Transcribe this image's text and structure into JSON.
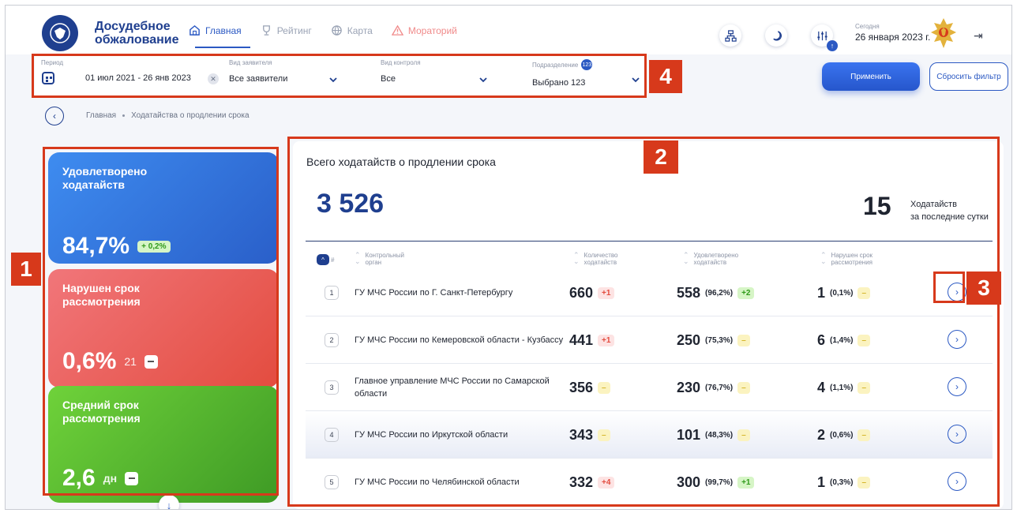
{
  "header": {
    "brand_line1": "Досудебное",
    "brand_line2": "обжалование",
    "nav": [
      {
        "label": "Главная",
        "icon": "home-icon"
      },
      {
        "label": "Рейтинг",
        "icon": "trophy-icon"
      },
      {
        "label": "Карта",
        "icon": "globe-icon"
      },
      {
        "label": "Мораторий",
        "icon": "warning-icon"
      }
    ],
    "today_label": "Сегодня",
    "today_value": "26 января 2023 г.",
    "notif_icon_mark": "↑"
  },
  "filters": {
    "period_label": "Период",
    "period_value": "01 июл 2021  -  26 янв 2023",
    "applicant_label": "Вид заявителя",
    "applicant_value": "Все заявители",
    "control_label": "Вид контроля",
    "control_value": "Все",
    "division_label": "Подразделение",
    "division_count": "123",
    "division_value": "Выбрано 123",
    "apply_label": "Применить",
    "reset_label": "Сбросить фильтр"
  },
  "breadcrumb": {
    "home": "Главная",
    "current": "Ходатайства о продлении срока"
  },
  "kpis": {
    "satisfied_title": "Удовлетворено ходатайств",
    "satisfied_value": "84,7%",
    "satisfied_delta": "+ 0,2%",
    "violated_title": "Нарушен срок рассмотрения",
    "violated_value": "0,6%",
    "violated_count": "21",
    "avg_title": "Средний срок рассмотрения",
    "avg_value": "2,6",
    "avg_unit": "дн"
  },
  "panel": {
    "title": "Всего ходатайств о продлении срока",
    "total": "3 526",
    "last_day_value": "15",
    "last_day_label_1": "Ходатайств",
    "last_day_label_2": "за последние сутки",
    "columns": {
      "num": "#",
      "org_1": "Контрольный",
      "org_2": "орган",
      "count_1": "Количество",
      "count_2": "ходатайств",
      "satisfied_1": "Удовлетворено",
      "satisfied_2": "ходатайств",
      "violated_1": "Нарушен срок",
      "violated_2": "рассмотрения"
    },
    "rows": [
      {
        "rank": "1",
        "org": "ГУ МЧС России по Г. Санкт-Петербургу",
        "count": "660",
        "count_delta": "+1",
        "satisfied": "558",
        "satisfied_pct": "(96,2%)",
        "satisfied_delta": "+2",
        "violated": "1",
        "violated_pct": "(0,1%)",
        "violated_delta": "–"
      },
      {
        "rank": "2",
        "org": "ГУ МЧС России по Кемеровской области - Кузбассу",
        "count": "441",
        "count_delta": "+1",
        "satisfied": "250",
        "satisfied_pct": "(75,3%)",
        "satisfied_delta": "–",
        "violated": "6",
        "violated_pct": "(1,4%)",
        "violated_delta": "–"
      },
      {
        "rank": "3",
        "org": "Главное управление МЧС России по Самарской области",
        "count": "356",
        "count_delta": "–",
        "satisfied": "230",
        "satisfied_pct": "(76,7%)",
        "satisfied_delta": "–",
        "violated": "4",
        "violated_pct": "(1,1%)",
        "violated_delta": "–"
      },
      {
        "rank": "4",
        "org": "ГУ МЧС России по Иркутской области",
        "count": "343",
        "count_delta": "–",
        "satisfied": "101",
        "satisfied_pct": "(48,3%)",
        "satisfied_delta": "–",
        "violated": "2",
        "violated_pct": "(0,6%)",
        "violated_delta": "–"
      },
      {
        "rank": "5",
        "org": "ГУ МЧС России по Челябинской области",
        "count": "332",
        "count_delta": "+4",
        "satisfied": "300",
        "satisfied_pct": "(99,7%)",
        "satisfied_delta": "+1",
        "violated": "1",
        "violated_pct": "(0,3%)",
        "violated_delta": "–"
      }
    ]
  },
  "annotations": [
    "1",
    "2",
    "3",
    "4"
  ],
  "colors": {
    "primary": "#1f3f8f",
    "accent": "#2b59c3",
    "annotation": "#d7391b",
    "kpi_blue": "#3e8cf0",
    "kpi_red": "#e34c3f",
    "kpi_green": "#3e9a25"
  }
}
